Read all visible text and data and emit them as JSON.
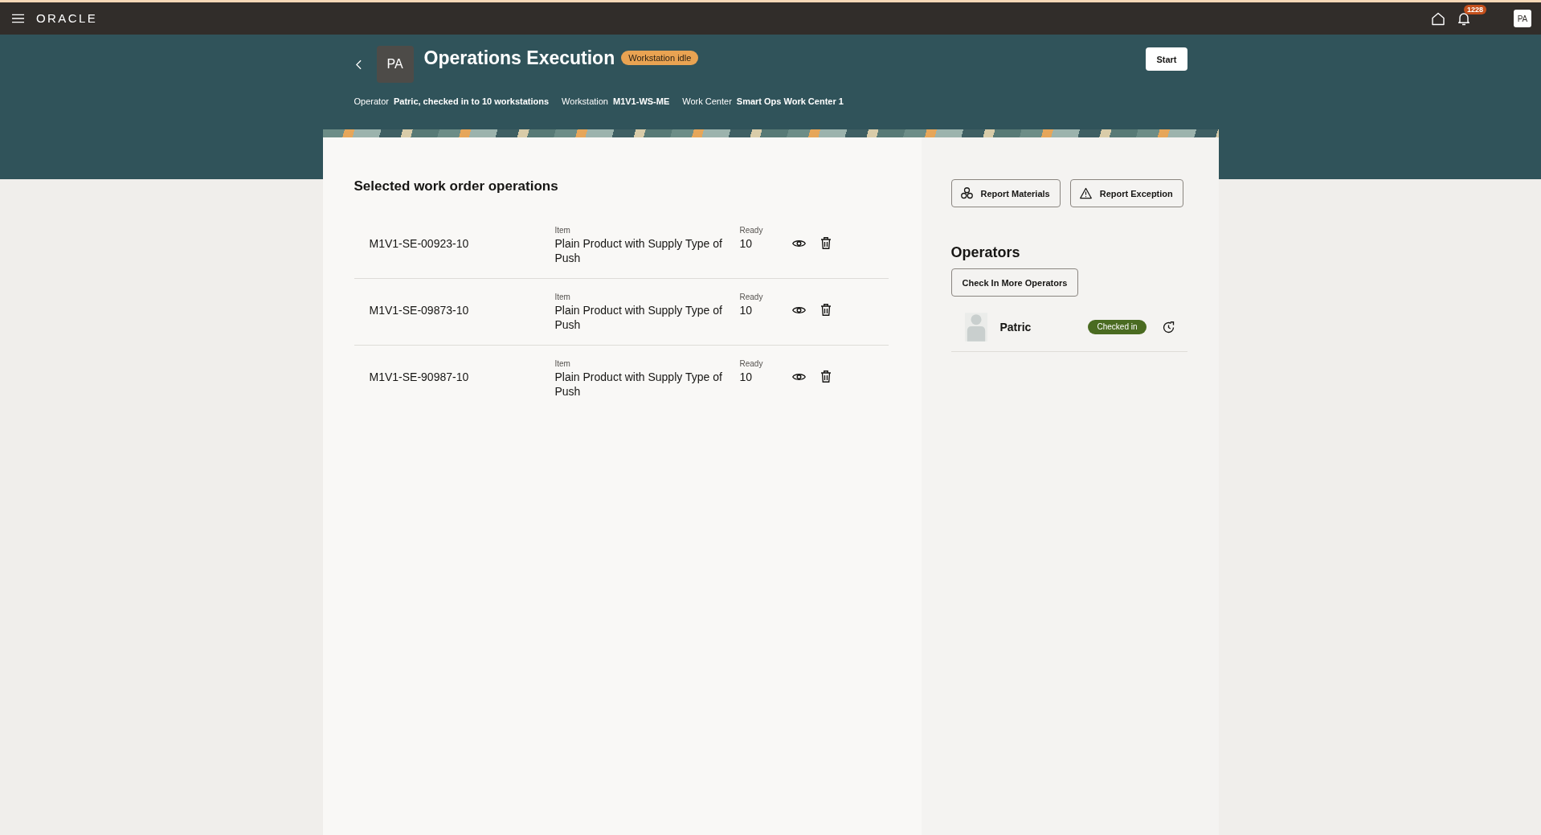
{
  "top_bar": {
    "logo": "ORACLE",
    "notification_count": "1228",
    "user_initials": "PA"
  },
  "header": {
    "avatar_initials": "PA",
    "title": "Operations Execution",
    "status": "Workstation idle",
    "start_button": "Start",
    "details": [
      {
        "label": "Operator",
        "value": "Patric, checked in to 10 workstations"
      },
      {
        "label": "Workstation",
        "value": "M1V1-WS-ME"
      },
      {
        "label": "Work Center",
        "value": "Smart Ops Work Center 1"
      }
    ]
  },
  "operations": {
    "heading": "Selected work order operations",
    "rows": [
      {
        "id": "M1V1-SE-00923-10",
        "item_label": "Item",
        "item": "Plain Product with Supply Type of Push",
        "ready_label": "Ready",
        "ready": "10"
      },
      {
        "id": "M1V1-SE-09873-10",
        "item_label": "Item",
        "item": "Plain Product with Supply Type of Push",
        "ready_label": "Ready",
        "ready": "10"
      },
      {
        "id": "M1V1-SE-90987-10",
        "item_label": "Item",
        "item": "Plain Product with Supply Type of Push",
        "ready_label": "Ready",
        "ready": "10"
      }
    ]
  },
  "actions": {
    "report_materials": "Report Materials",
    "report_exception": "Report Exception"
  },
  "operators": {
    "heading": "Operators",
    "check_in_button": "Check In More Operators",
    "list": [
      {
        "name": "Patric",
        "status": "Checked in"
      }
    ]
  }
}
